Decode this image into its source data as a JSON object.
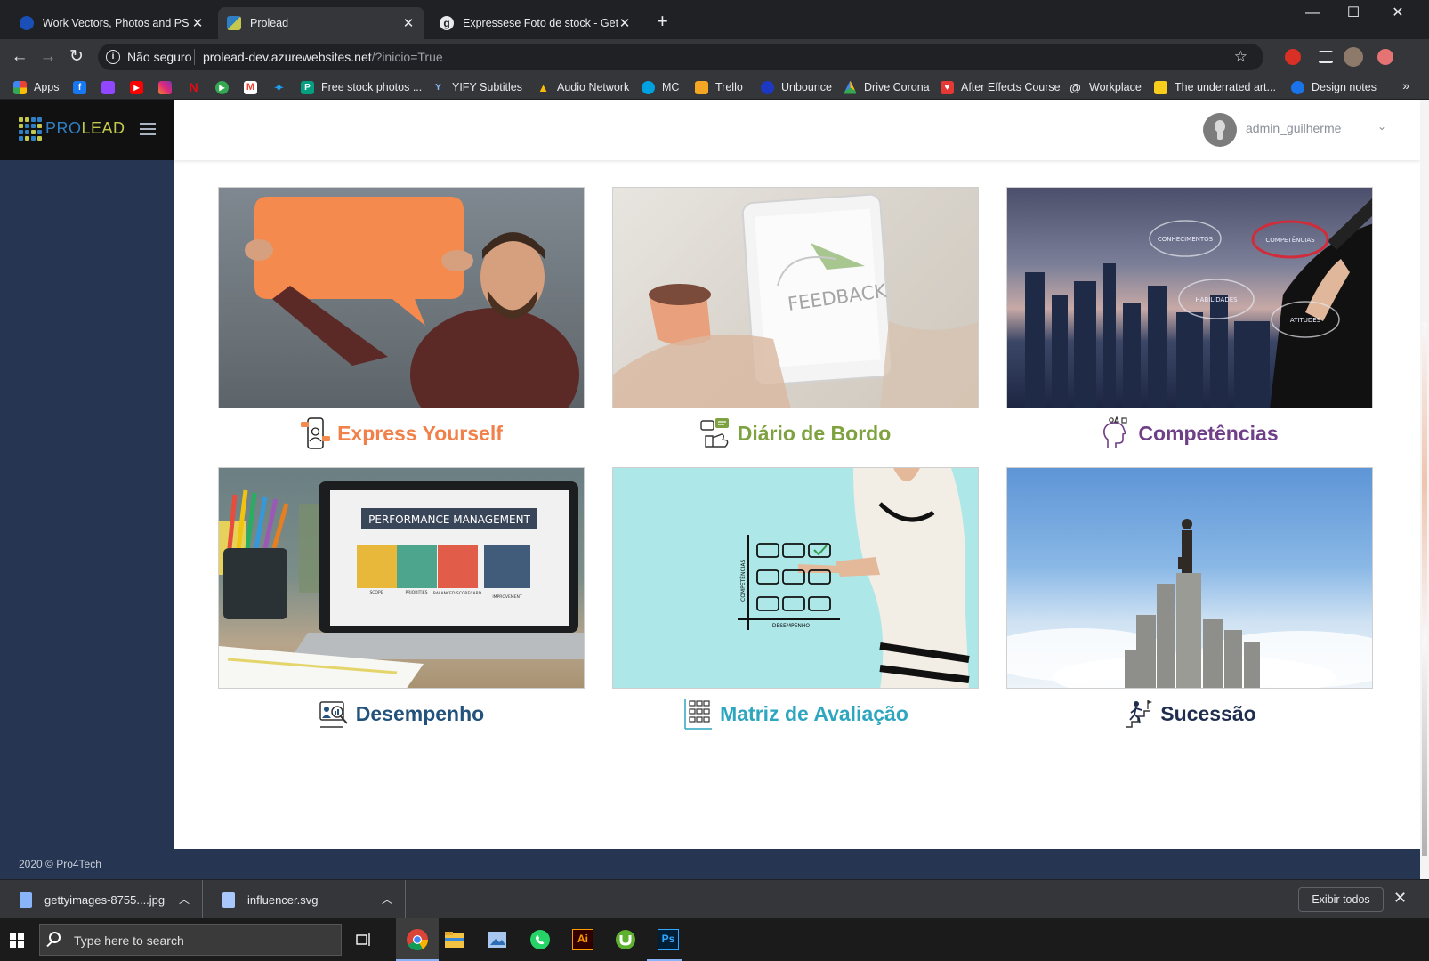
{
  "browser": {
    "tabs": [
      {
        "title": "Work Vectors, Photos and PSD fil",
        "active": false
      },
      {
        "title": "Prolead",
        "active": true
      },
      {
        "title": "Expressese Foto de stock - Getty",
        "active": false
      }
    ],
    "security_label": "Não seguro",
    "url_host": "prolead-dev.azurewebsites.net",
    "url_rest": "/?inicio=True",
    "bookmarks": [
      {
        "label": "Apps",
        "icon": "apps-grid-icon"
      },
      {
        "label": "",
        "icon": "facebook-icon"
      },
      {
        "label": "",
        "icon": "twitch-icon"
      },
      {
        "label": "",
        "icon": "youtube-icon"
      },
      {
        "label": "",
        "icon": "instagram-icon"
      },
      {
        "label": "",
        "icon": "netflix-icon"
      },
      {
        "label": "",
        "icon": "play-icon"
      },
      {
        "label": "",
        "icon": "gmail-icon"
      },
      {
        "label": "",
        "icon": "twitter-icon"
      },
      {
        "label": "Free stock photos ...",
        "icon": "pexels-icon"
      },
      {
        "label": "YIFY Subtitles",
        "icon": "yify-icon"
      },
      {
        "label": "Audio Network",
        "icon": "audio-network-icon"
      },
      {
        "label": "MC",
        "icon": "salesforce-cloud-icon"
      },
      {
        "label": "Trello",
        "icon": "trello-icon"
      },
      {
        "label": "Unbounce",
        "icon": "unbounce-icon"
      },
      {
        "label": "Drive Corona",
        "icon": "google-drive-icon"
      },
      {
        "label": "After Effects Course",
        "icon": "course-icon"
      },
      {
        "label": "Workplace",
        "icon": "workplace-icon"
      },
      {
        "label": "The underrated art...",
        "icon": "folder-icon"
      },
      {
        "label": "Design notes",
        "icon": "design-notes-icon"
      }
    ]
  },
  "app": {
    "logo_pro": "PRO",
    "logo_lead": "LEAD",
    "username": "admin_guilherme",
    "footer": "2020 © Pro4Tech",
    "tiles": [
      {
        "label": "Express Yourself",
        "color": "#f0814a",
        "icon": "influencer-icon"
      },
      {
        "label": "Diário de Bordo",
        "color": "#7ea23f",
        "icon": "feedback-chat-icon"
      },
      {
        "label": "Competências",
        "color": "#6f3f88",
        "icon": "head-ideas-icon"
      },
      {
        "label": "Desempenho",
        "color": "#23527c",
        "icon": "performance-analysis-icon"
      },
      {
        "label": "Matriz de Avaliação",
        "color": "#2ea6c0",
        "icon": "matrix-grid-icon"
      },
      {
        "label": "Sucessão",
        "color": "#1f2d4f",
        "icon": "climbing-person-icon"
      }
    ],
    "image_text": {
      "feedback": "FEEDBACK",
      "competencias_bubbles": [
        "CONHECIMENTOS",
        "COMPETÊNCIAS",
        "HABILIDADES",
        "ATITUDES"
      ],
      "performance_title": "PERFORMANCE MANAGEMENT",
      "performance_cards": [
        "SCOPE",
        "PRIORITIES",
        "BALANCED SCORECARD",
        "IMPROVEMENT"
      ],
      "matrix_y": "COMPETÊNCIAS",
      "matrix_x": "DESEMPENHO"
    }
  },
  "downloads": {
    "items": [
      {
        "name": "gettyimages-8755....jpg",
        "icon": "image-file-icon"
      },
      {
        "name": "influencer.svg",
        "icon": "svg-file-icon"
      }
    ],
    "show_all": "Exibir todos"
  },
  "taskbar": {
    "search_placeholder": "Type here to search",
    "apps": [
      "task-view-icon",
      "chrome-icon",
      "file-explorer-icon",
      "photos-icon",
      "whatsapp-icon",
      "illustrator-icon",
      "utorrent-icon",
      "photoshop-icon"
    ],
    "illustrator_label": "Ai",
    "photoshop_label": "Ps"
  }
}
